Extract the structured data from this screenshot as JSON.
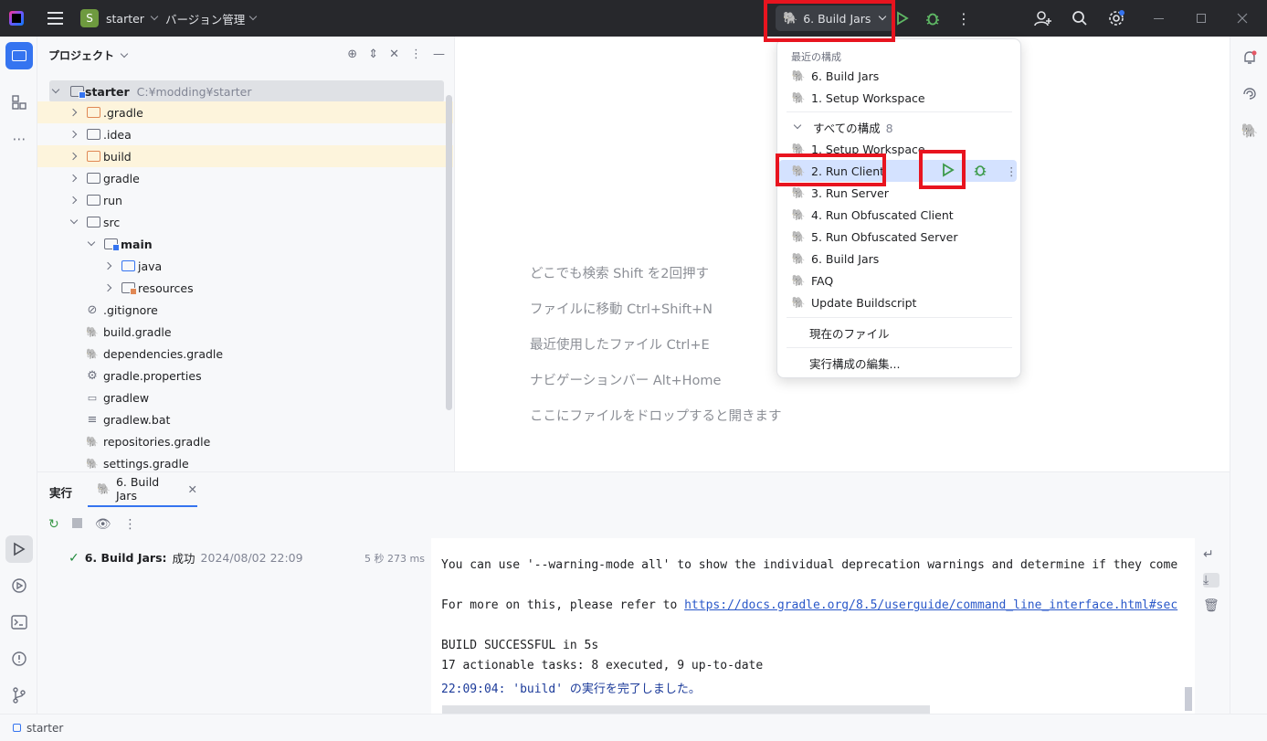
{
  "titlebar": {
    "project_badge": "S",
    "project_name": "starter",
    "vcs_label": "バージョン管理",
    "run_config": "6. Build Jars"
  },
  "project_panel": {
    "title": "プロジェクト",
    "tree": [
      {
        "label": "starter",
        "path": "C:¥modding¥starter"
      },
      {
        "label": ".gradle"
      },
      {
        "label": ".idea"
      },
      {
        "label": "build"
      },
      {
        "label": "gradle"
      },
      {
        "label": "run"
      },
      {
        "label": "src"
      },
      {
        "label": "main"
      },
      {
        "label": "java"
      },
      {
        "label": "resources"
      },
      {
        "label": ".gitignore"
      },
      {
        "label": "build.gradle"
      },
      {
        "label": "dependencies.gradle"
      },
      {
        "label": "gradle.properties"
      },
      {
        "label": "gradlew"
      },
      {
        "label": "gradlew.bat"
      },
      {
        "label": "repositories.gradle"
      },
      {
        "label": "settings.gradle"
      }
    ]
  },
  "editor_hints": [
    "どこでも検索 Shift を2回押す",
    "ファイルに移動 Ctrl+Shift+N",
    "最近使用したファイル Ctrl+E",
    "ナビゲーションバー Alt+Home",
    "ここにファイルをドロップすると開きます"
  ],
  "popup": {
    "recent_header": "最近の構成",
    "recent": [
      "6. Build Jars",
      "1. Setup Workspace"
    ],
    "all_header": "すべての構成",
    "all_count": "8",
    "all": [
      "1. Setup Workspace",
      "2. Run Client",
      "3. Run Server",
      "4. Run Obfuscated Client",
      "5. Run Obfuscated Server",
      "6. Build Jars",
      "FAQ",
      "Update Buildscript"
    ],
    "current_file": "現在のファイル",
    "edit_configs": "実行構成の編集..."
  },
  "run_window": {
    "title": "実行",
    "tab_label": "6. Build Jars",
    "item_name": "6. Build Jars:",
    "item_status": "成功",
    "item_date": "2024/08/02 22:09",
    "item_duration": "5 秒 273 ms",
    "console": {
      "line1": "You can use '--warning-mode all' to show the individual deprecation warnings and determine if they come",
      "line2_prefix": "For more on this, please refer to ",
      "line2_link": "https://docs.gradle.org/8.5/userguide/command_line_interface.html#sec",
      "line3": "BUILD SUCCESSFUL in 5s",
      "line4": "17 actionable tasks: 8 executed, 9 up-to-date",
      "line5": "22:09:04:  'build' の実行を完了しました。"
    }
  },
  "statusbar": {
    "label": "starter"
  },
  "colors": {
    "accent": "#3574f0",
    "highlight_box": "#e8141f",
    "run_green": "#3c9a4a",
    "titlebar_bg": "#27282c"
  }
}
